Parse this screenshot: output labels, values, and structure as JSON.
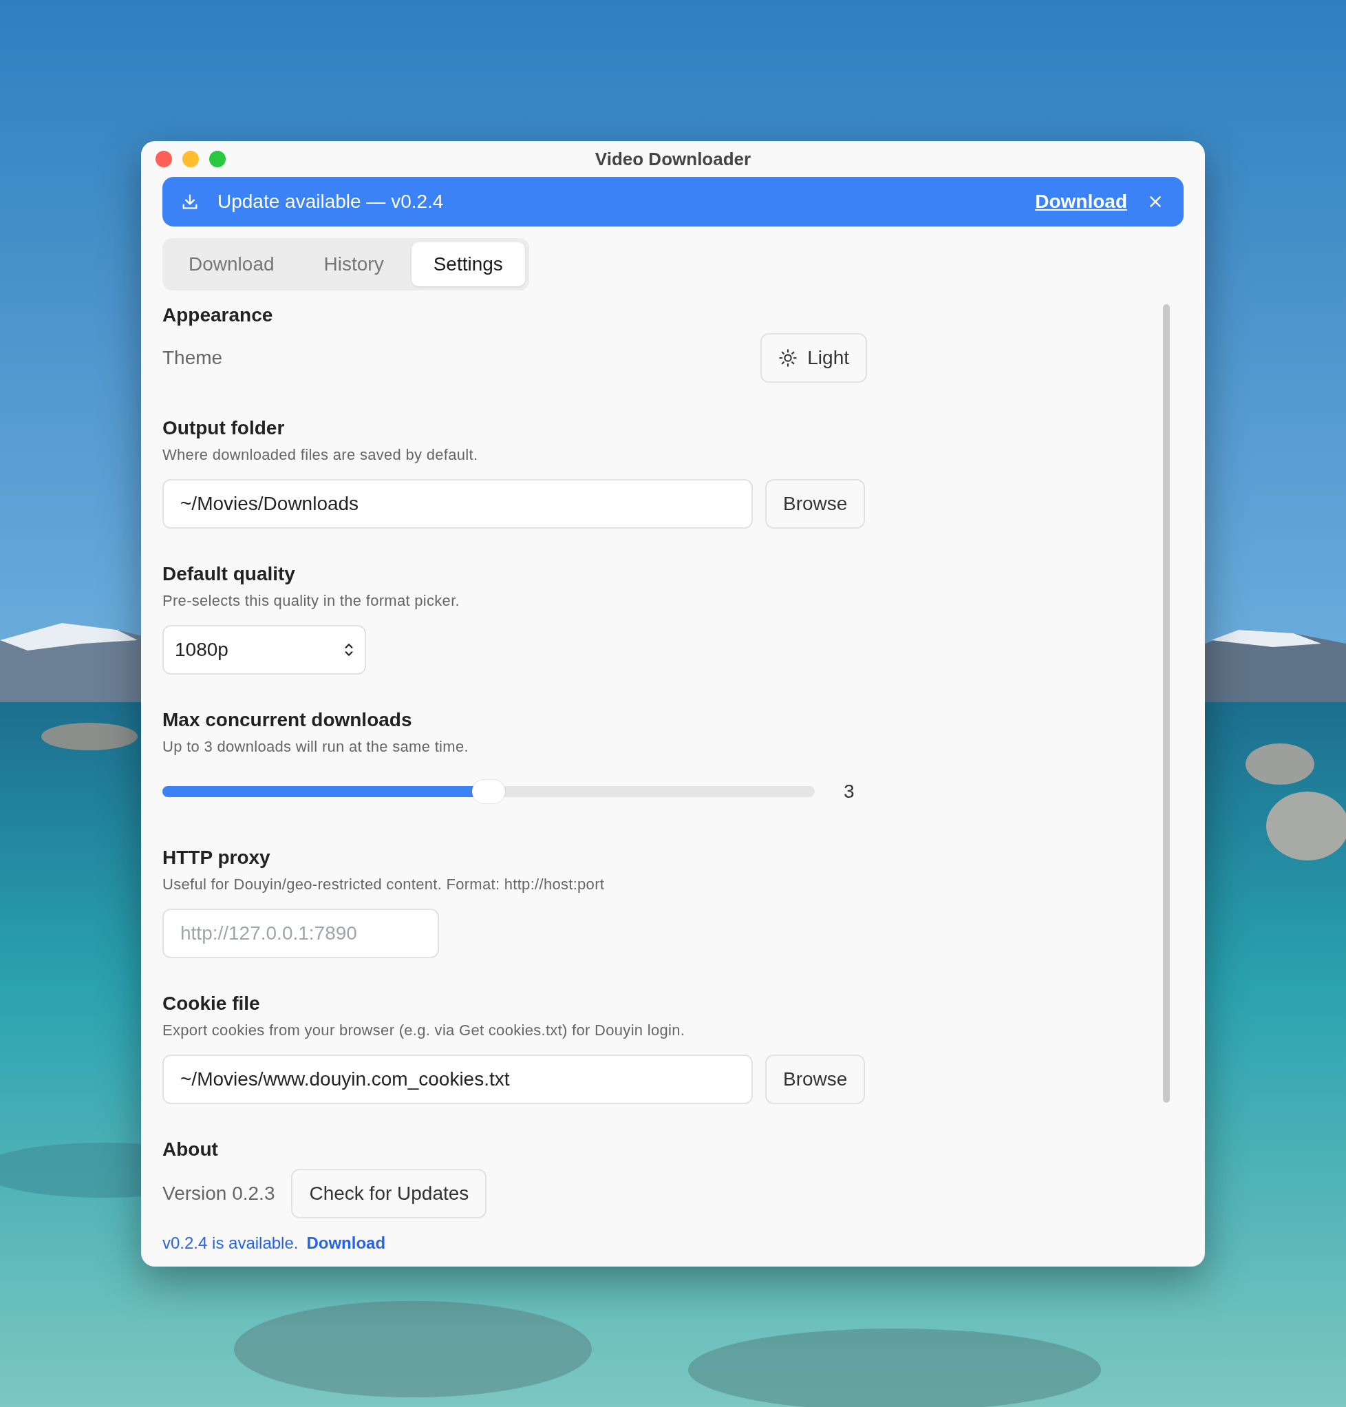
{
  "window": {
    "title": "Video Downloader"
  },
  "update_banner": {
    "text": "Update available — v0.2.4",
    "action": "Download"
  },
  "tabs": [
    {
      "label": "Download",
      "selected": false
    },
    {
      "label": "History",
      "selected": false
    },
    {
      "label": "Settings",
      "selected": true
    }
  ],
  "sections": [
    {
      "kind": "theme",
      "heading": "Appearance",
      "label": "Theme",
      "value": "Light"
    },
    {
      "kind": "path",
      "heading": "Output folder",
      "description": "Where downloaded files are saved by default.",
      "value": "~/Movies/Downloads",
      "button": "Browse"
    },
    {
      "kind": "select",
      "heading": "Default quality",
      "description": "Pre-selects this quality in the format picker.",
      "value": "1080p"
    },
    {
      "kind": "slider",
      "heading": "Max concurrent downloads",
      "description": "Up to 3 downloads will run at the same time.",
      "level": 0.5,
      "reading": "3"
    },
    {
      "kind": "text",
      "heading": "HTTP proxy",
      "description": "Useful for Douyin/geo-restricted content. Format: http://host:port",
      "placeholder": "http://127.0.0.1:7890"
    },
    {
      "kind": "path",
      "heading": "Cookie file",
      "description": "Export cookies from your browser (e.g. via Get cookies.txt) for Douyin login.",
      "value": "~/Movies/www.douyin.com_cookies.txt",
      "button": "Browse"
    },
    {
      "kind": "about",
      "heading": "About",
      "version": "Version 0.2.3",
      "button": "Check for Updates",
      "notice": "v0.2.4 is available.",
      "link": "Download"
    }
  ]
}
